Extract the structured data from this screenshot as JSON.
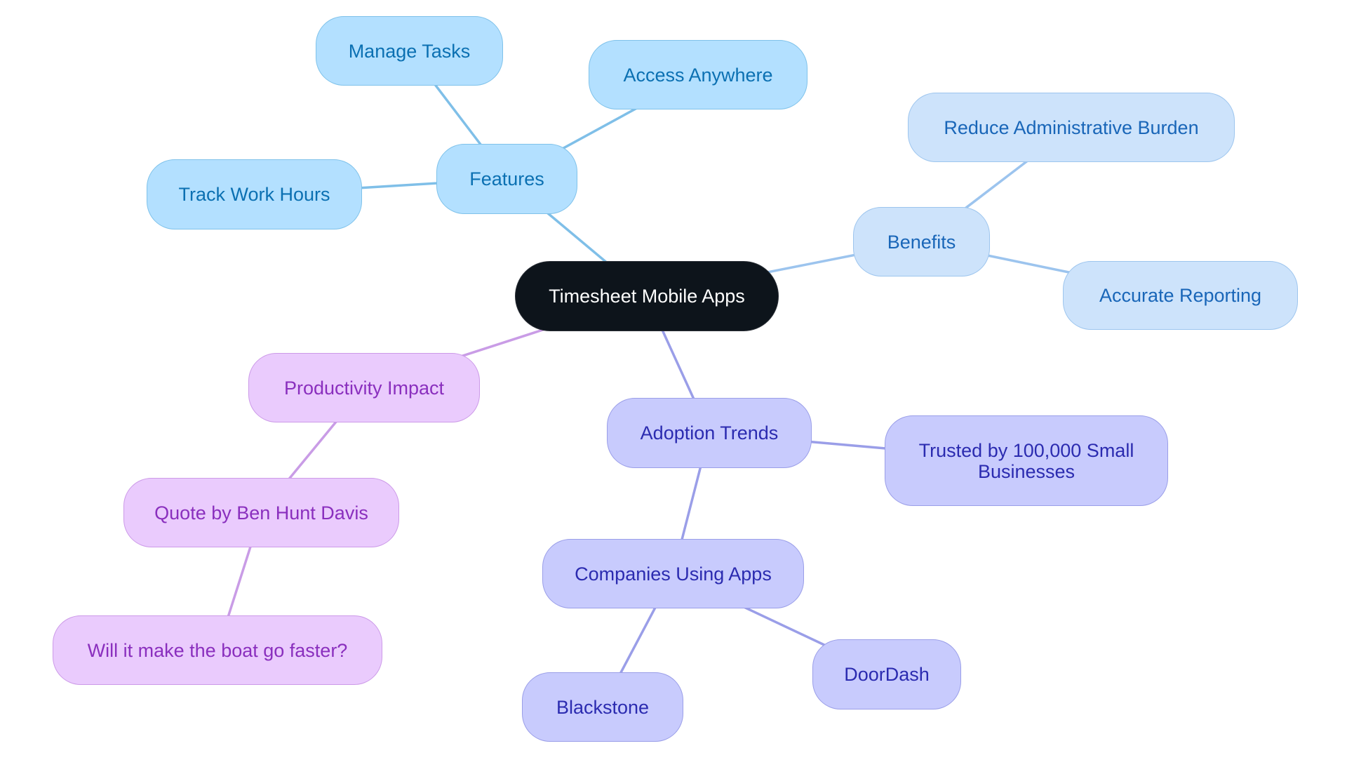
{
  "title": "Timesheet Mobile Apps",
  "colors": {
    "root_fill": "#0d141b",
    "features_fill": "#b3e0ff",
    "features_edge": "#7fbfe8",
    "benefits_fill": "#cde3fb",
    "benefits_edge": "#9cc4ee",
    "adoption_fill": "#c8cbfd",
    "adoption_edge": "#9a9ee8",
    "productivity_fill": "#eacbfd",
    "productivity_edge": "#c99ce6"
  },
  "nodes": {
    "root": "Timesheet Mobile Apps",
    "features": "Features",
    "manage_tasks": "Manage Tasks",
    "access_anywhere": "Access Anywhere",
    "track_work_hours": "Track Work Hours",
    "benefits": "Benefits",
    "reduce_burden": "Reduce Administrative Burden",
    "accurate_reporting": "Accurate Reporting",
    "productivity": "Productivity Impact",
    "quote": "Quote by Ben Hunt Davis",
    "boat": "Will it make the boat go faster?",
    "adoption": "Adoption Trends",
    "trusted_line1": "Trusted by 100,000 Small",
    "trusted_line2": "Businesses",
    "companies": "Companies Using Apps",
    "doordash": "DoorDash",
    "blackstone": "Blackstone"
  },
  "edges": [
    {
      "from": "root",
      "to": "features",
      "branch": "features"
    },
    {
      "from": "features",
      "to": "manage_tasks",
      "branch": "features"
    },
    {
      "from": "features",
      "to": "access_anywhere",
      "branch": "features"
    },
    {
      "from": "features",
      "to": "track_work_hours",
      "branch": "features"
    },
    {
      "from": "root",
      "to": "benefits",
      "branch": "benefits"
    },
    {
      "from": "benefits",
      "to": "reduce_burden",
      "branch": "benefits"
    },
    {
      "from": "benefits",
      "to": "accurate_reporting",
      "branch": "benefits"
    },
    {
      "from": "root",
      "to": "productivity",
      "branch": "productivity"
    },
    {
      "from": "productivity",
      "to": "quote",
      "branch": "productivity"
    },
    {
      "from": "quote",
      "to": "boat",
      "branch": "productivity"
    },
    {
      "from": "root",
      "to": "adoption",
      "branch": "adoption"
    },
    {
      "from": "adoption",
      "to": "trusted",
      "branch": "adoption"
    },
    {
      "from": "adoption",
      "to": "companies",
      "branch": "adoption"
    },
    {
      "from": "companies",
      "to": "doordash",
      "branch": "adoption"
    },
    {
      "from": "companies",
      "to": "blackstone",
      "branch": "adoption"
    }
  ]
}
